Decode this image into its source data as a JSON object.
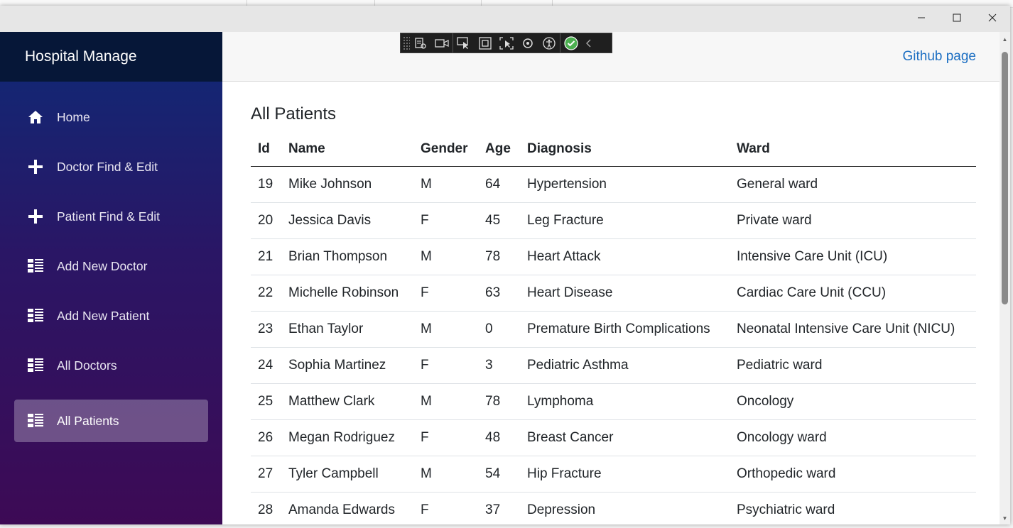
{
  "app": {
    "brand": "Hospital Manage",
    "github_link": "Github page"
  },
  "sidebar": {
    "items": [
      {
        "label": "Home",
        "icon": "home-icon",
        "active": false
      },
      {
        "label": "Doctor Find & Edit",
        "icon": "plus-icon",
        "active": false
      },
      {
        "label": "Patient Find & Edit",
        "icon": "plus-icon",
        "active": false
      },
      {
        "label": "Add New Doctor",
        "icon": "list-icon",
        "active": false
      },
      {
        "label": "Add New Patient",
        "icon": "list-icon",
        "active": false
      },
      {
        "label": "All Doctors",
        "icon": "list-icon",
        "active": false
      },
      {
        "label": "All Patients",
        "icon": "list-icon",
        "active": true
      }
    ]
  },
  "page": {
    "title": "All Patients"
  },
  "table": {
    "headers": [
      "Id",
      "Name",
      "Gender",
      "Age",
      "Diagnosis",
      "Ward"
    ],
    "rows": [
      [
        "19",
        "Mike Johnson",
        "M",
        "64",
        "Hypertension",
        "General ward"
      ],
      [
        "20",
        "Jessica Davis",
        "F",
        "45",
        "Leg Fracture",
        "Private ward"
      ],
      [
        "21",
        "Brian Thompson",
        "M",
        "78",
        "Heart Attack",
        "Intensive Care Unit (ICU)"
      ],
      [
        "22",
        "Michelle Robinson",
        "F",
        "63",
        "Heart Disease",
        "Cardiac Care Unit (CCU)"
      ],
      [
        "23",
        "Ethan Taylor",
        "M",
        "0",
        "Premature Birth Complications",
        "Neonatal Intensive Care Unit (NICU)"
      ],
      [
        "24",
        "Sophia Martinez",
        "F",
        "3",
        "Pediatric Asthma",
        "Pediatric ward"
      ],
      [
        "25",
        "Matthew Clark",
        "M",
        "78",
        "Lymphoma",
        "Oncology"
      ],
      [
        "26",
        "Megan Rodriguez",
        "F",
        "48",
        "Breast Cancer",
        "Oncology ward"
      ],
      [
        "27",
        "Tyler Campbell",
        "M",
        "54",
        "Hip Fracture",
        "Orthopedic ward"
      ],
      [
        "28",
        "Amanda Edwards",
        "F",
        "37",
        "Depression",
        "Psychiatric ward"
      ]
    ]
  },
  "colors": {
    "sidebar_top": "#0e2a77",
    "sidebar_bottom": "#3d0a55",
    "brand_bg": "#061738",
    "link": "#1b6ec2",
    "active_item": "rgba(255,255,255,0.28)"
  },
  "vs_toolbar": {
    "icons": [
      "live-visual-tree-icon",
      "record-icon",
      "select-element-icon",
      "display-layout-adorners-icon",
      "track-focus-icon",
      "hot-reload-icon",
      "accessibility-icon",
      "check-icon",
      "collapse-icon"
    ]
  }
}
